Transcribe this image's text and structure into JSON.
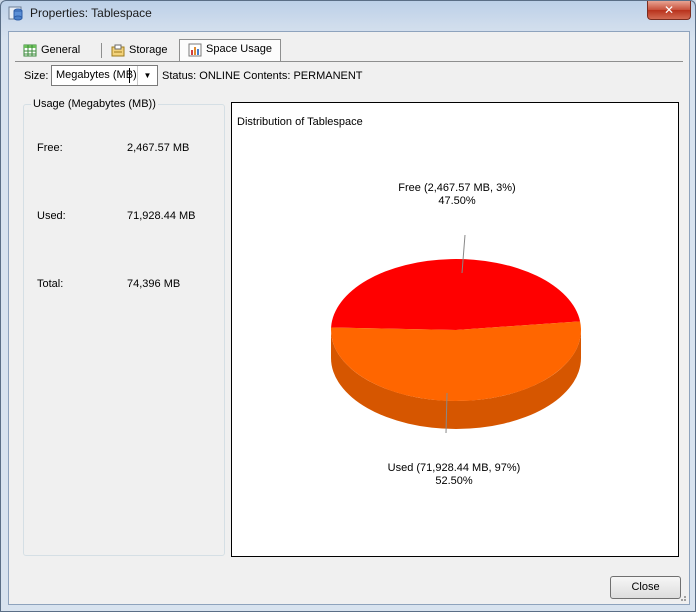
{
  "window": {
    "title": "Properties: Tablespace",
    "close_glyph": "✕"
  },
  "tabs": [
    {
      "label": "General",
      "icon": "table-grid-icon",
      "active": false
    },
    {
      "label": "Storage",
      "icon": "storage-icon",
      "active": false
    },
    {
      "label": "Space Usage",
      "icon": "chart-icon",
      "active": true
    }
  ],
  "header": {
    "size_label": "Size:",
    "size_value": "Megabytes (MB)",
    "status_text": "Status: ONLINE  Contents: PERMANENT"
  },
  "usage": {
    "legend": "Usage (Megabytes (MB))",
    "rows": [
      {
        "label": "Free:",
        "value": "2,467.57 MB"
      },
      {
        "label": "Used:",
        "value": "71,928.44 MB"
      },
      {
        "label": "Total:",
        "value": "74,396 MB"
      }
    ]
  },
  "chart_data": {
    "type": "pie",
    "title": "Distribution of Tablespace",
    "series": [
      {
        "name": "Free",
        "label_line1": "Free (2,467.57 MB, 3%)",
        "label_line2": "47.50%",
        "value": 47.5,
        "color": "#ff0000"
      },
      {
        "name": "Used",
        "label_line1": "Used (71,928.44 MB, 97%)",
        "label_line2": "52.50%",
        "value": 52.5,
        "color": "#ff6600"
      }
    ],
    "style": "3d"
  },
  "footer": {
    "close_label": "Close"
  }
}
